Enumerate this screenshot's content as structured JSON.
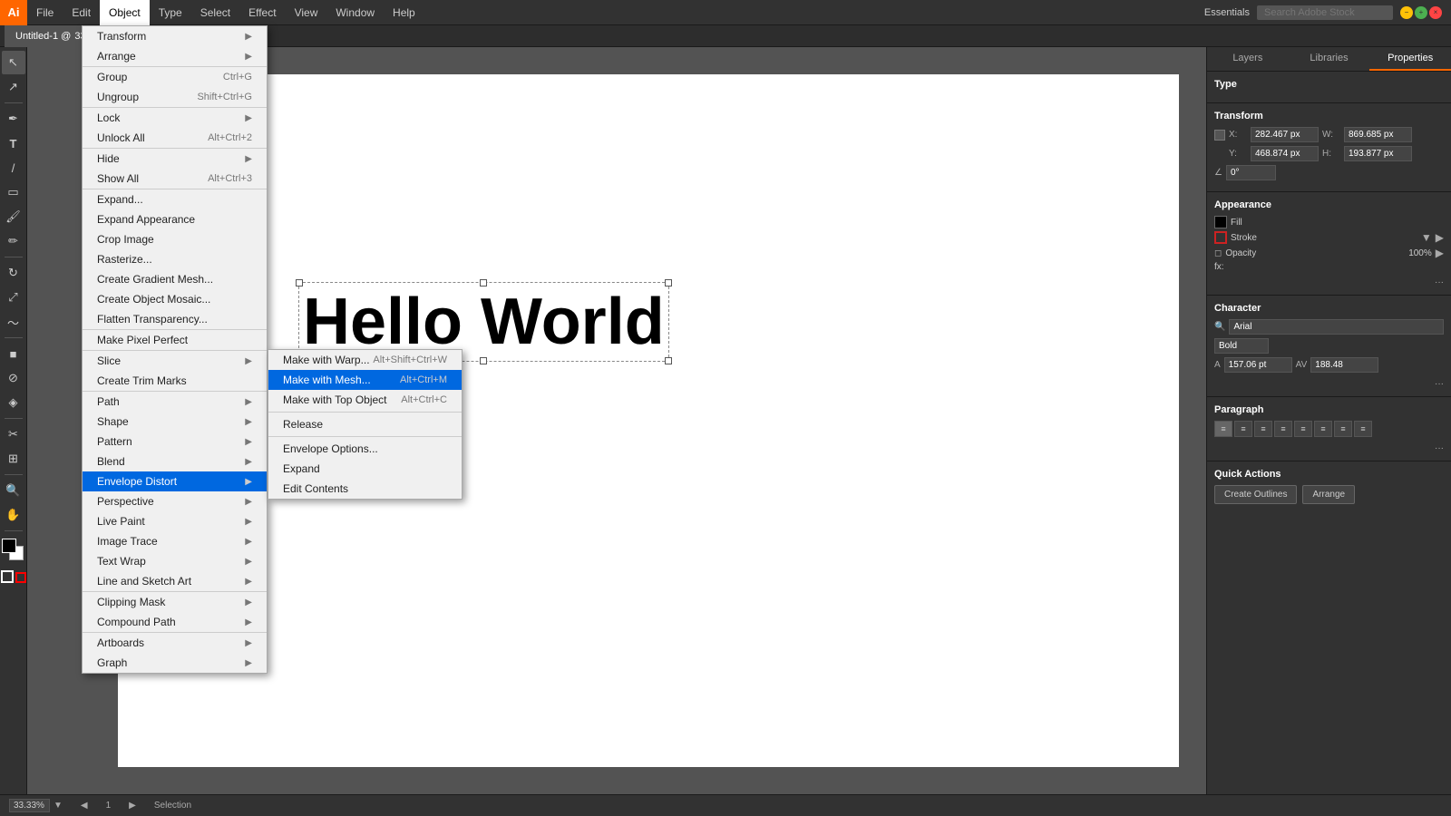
{
  "app": {
    "logo": "Ai",
    "title": "Untitled-1",
    "zoom": "33.33%",
    "page": "1",
    "tool": "Selection"
  },
  "menubar": {
    "items": [
      "File",
      "Edit",
      "Object",
      "Type",
      "Select",
      "Effect",
      "View",
      "Window",
      "Help"
    ],
    "active": "Object",
    "essentials": "Essentials",
    "search_placeholder": "Search Adobe Stock"
  },
  "tab": {
    "label": "Untitled-1 @"
  },
  "object_menu": {
    "items": [
      {
        "label": "Transform",
        "shortcut": "",
        "arrow": true,
        "section": 1
      },
      {
        "label": "Arrange",
        "shortcut": "",
        "arrow": true,
        "section": 1
      },
      {
        "label": "Group",
        "shortcut": "Ctrl+G",
        "section": 2
      },
      {
        "label": "Ungroup",
        "shortcut": "Shift+Ctrl+G",
        "section": 2
      },
      {
        "label": "Lock",
        "shortcut": "",
        "arrow": true,
        "section": 3
      },
      {
        "label": "Unlock All",
        "shortcut": "Alt+Ctrl+2",
        "section": 3
      },
      {
        "label": "Hide",
        "shortcut": "",
        "arrow": true,
        "section": 4
      },
      {
        "label": "Show All",
        "shortcut": "Alt+Ctrl+3",
        "section": 4
      },
      {
        "label": "Expand...",
        "shortcut": "",
        "section": 5
      },
      {
        "label": "Expand Appearance",
        "shortcut": "",
        "section": 5
      },
      {
        "label": "Crop Image",
        "shortcut": "",
        "section": 5
      },
      {
        "label": "Rasterize...",
        "shortcut": "",
        "section": 5
      },
      {
        "label": "Create Gradient Mesh...",
        "shortcut": "",
        "section": 5
      },
      {
        "label": "Create Object Mosaic...",
        "shortcut": "",
        "section": 5
      },
      {
        "label": "Flatten Transparency...",
        "shortcut": "",
        "section": 5
      },
      {
        "label": "Make Pixel Perfect",
        "shortcut": "",
        "section": 6
      },
      {
        "label": "Slice",
        "shortcut": "",
        "arrow": true,
        "section": 7
      },
      {
        "label": "Create Trim Marks",
        "shortcut": "",
        "section": 7
      },
      {
        "label": "Path",
        "shortcut": "",
        "arrow": true,
        "section": 8
      },
      {
        "label": "Shape",
        "shortcut": "",
        "arrow": true,
        "section": 8
      },
      {
        "label": "Pattern",
        "shortcut": "",
        "arrow": true,
        "section": 8
      },
      {
        "label": "Blend",
        "shortcut": "",
        "arrow": true,
        "section": 8
      },
      {
        "label": "Envelope Distort",
        "shortcut": "",
        "arrow": true,
        "highlighted": true,
        "section": 8
      },
      {
        "label": "Perspective",
        "shortcut": "",
        "arrow": true,
        "section": 8
      },
      {
        "label": "Live Paint",
        "shortcut": "",
        "arrow": true,
        "section": 8
      },
      {
        "label": "Image Trace",
        "shortcut": "",
        "arrow": true,
        "section": 8
      },
      {
        "label": "Text Wrap",
        "shortcut": "",
        "arrow": true,
        "section": 8
      },
      {
        "label": "Line and Sketch Art",
        "shortcut": "",
        "arrow": true,
        "section": 8
      },
      {
        "label": "Clipping Mask",
        "shortcut": "",
        "arrow": true,
        "section": 9
      },
      {
        "label": "Compound Path",
        "shortcut": "",
        "arrow": true,
        "section": 9
      },
      {
        "label": "Artboards",
        "shortcut": "",
        "arrow": true,
        "section": 10
      },
      {
        "label": "Graph",
        "shortcut": "",
        "arrow": true,
        "section": 10
      }
    ]
  },
  "envelope_submenu": {
    "items": [
      {
        "label": "Make with Warp...",
        "shortcut": "Alt+Shift+Ctrl+W"
      },
      {
        "label": "Make with Mesh...",
        "shortcut": "Alt+Ctrl+M",
        "highlighted": true
      },
      {
        "label": "Make with Top Object",
        "shortcut": "Alt+Ctrl+C"
      },
      {
        "label": "Release",
        "shortcut": ""
      },
      {
        "label": "Envelope Options...",
        "shortcut": ""
      },
      {
        "label": "Expand",
        "shortcut": ""
      },
      {
        "label": "Edit Contents",
        "shortcut": ""
      }
    ]
  },
  "canvas": {
    "text": "Hello World"
  },
  "right_panel": {
    "tabs": [
      "Layers",
      "Libraries",
      "Properties"
    ],
    "active_tab": "Properties",
    "sections": {
      "type": {
        "title": "Type"
      },
      "transform": {
        "title": "Transform",
        "x_label": "X:",
        "x_value": "282.467 px",
        "w_label": "W:",
        "w_value": "869.685 px",
        "y_label": "Y:",
        "y_value": "468.874 px",
        "h_label": "H:",
        "h_value": "193.877 px",
        "angle": "0°"
      },
      "appearance": {
        "title": "Appearance",
        "fill_label": "Fill",
        "stroke_label": "Stroke",
        "opacity_label": "Opacity",
        "opacity_value": "100%",
        "fx_label": "fx:"
      },
      "character": {
        "title": "Character",
        "font": "Arial",
        "style": "Bold",
        "size": "157.06 pt",
        "tracking": "188.48"
      },
      "paragraph": {
        "title": "Paragraph"
      },
      "quick_actions": {
        "title": "Quick Actions",
        "btn1": "Create Outlines",
        "btn2": "Arrange"
      }
    }
  },
  "statusbar": {
    "zoom": "33.33%",
    "page": "1",
    "tool": "Selection"
  },
  "tools": [
    {
      "name": "selection-tool",
      "icon": "↖"
    },
    {
      "name": "direct-selection-tool",
      "icon": "↗"
    },
    {
      "name": "pen-tool",
      "icon": "✒"
    },
    {
      "name": "type-tool",
      "icon": "T"
    },
    {
      "name": "line-tool",
      "icon": "/"
    },
    {
      "name": "rectangle-tool",
      "icon": "▭"
    },
    {
      "name": "paintbrush-tool",
      "icon": "🖌"
    },
    {
      "name": "pencil-tool",
      "icon": "✏"
    },
    {
      "name": "rotate-tool",
      "icon": "↻"
    },
    {
      "name": "scale-tool",
      "icon": "⤢"
    },
    {
      "name": "warp-tool",
      "icon": "~"
    },
    {
      "name": "gradient-tool",
      "icon": "■"
    },
    {
      "name": "eyedropper-tool",
      "icon": "⊘"
    },
    {
      "name": "blend-tool",
      "icon": "◈"
    },
    {
      "name": "scissors-tool",
      "icon": "✂"
    },
    {
      "name": "artboard-tool",
      "icon": "⊞"
    },
    {
      "name": "zoom-tool",
      "icon": "🔍"
    },
    {
      "name": "hand-tool",
      "icon": "✋"
    }
  ]
}
